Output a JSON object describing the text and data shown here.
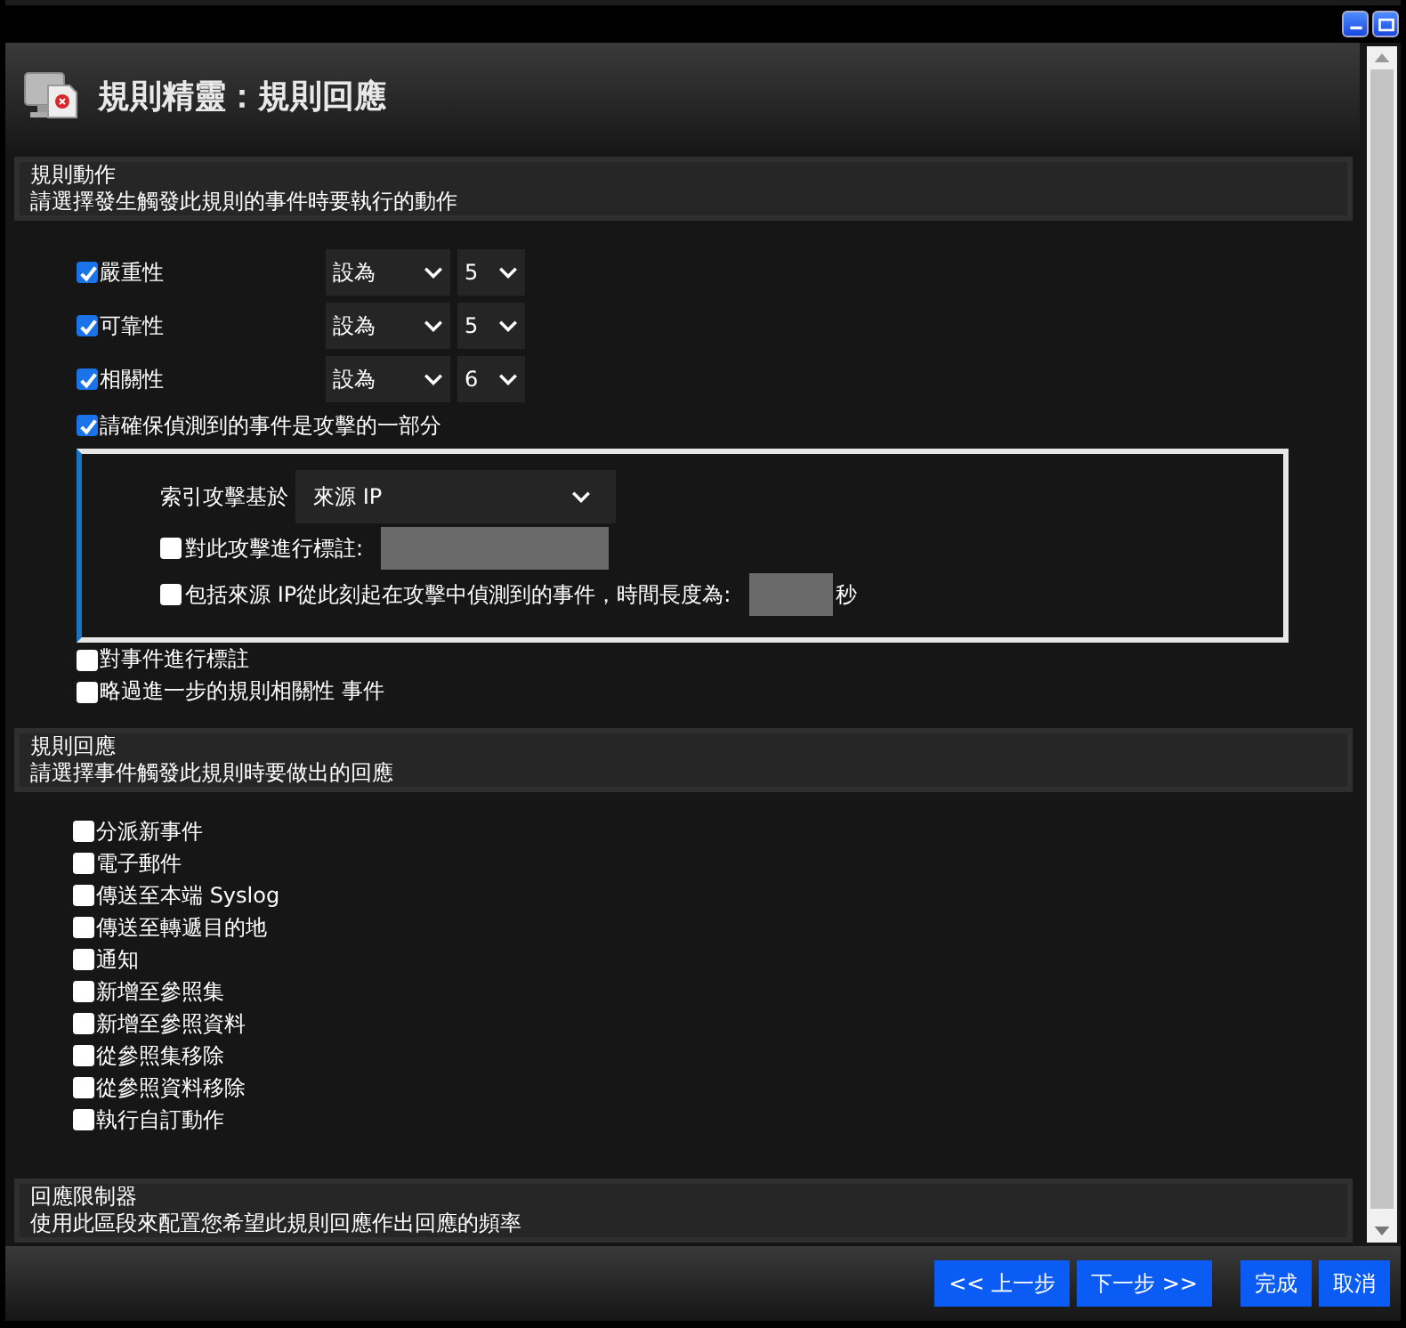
{
  "header": {
    "title": "規則精靈：規則回應"
  },
  "rule_action": {
    "title": "規則動作",
    "description": "請選擇發生觸發此規則的事件時要執行的動作",
    "properties": [
      {
        "label": "嚴重性",
        "checked": true,
        "operator": "設為",
        "value": "5"
      },
      {
        "label": "可靠性",
        "checked": true,
        "operator": "設為",
        "value": "5"
      },
      {
        "label": "相關性",
        "checked": true,
        "operator": "設為",
        "value": "6"
      }
    ],
    "attack": {
      "label": "請確保偵測到的事件是攻擊的一部分",
      "checked": true,
      "index_label": "索引攻擊基於",
      "index_value": "來源 IP",
      "annotate": {
        "label": "對此攻擊進行標註:",
        "checked": false
      },
      "include": {
        "label": "包括來源 IP從此刻起在攻擊中偵測到的事件，時間長度為:",
        "checked": false,
        "unit": "秒"
      }
    },
    "extras": [
      {
        "label": "對事件進行標註",
        "checked": false
      },
      {
        "label": "略過進一步的規則相關性 事件",
        "checked": false
      }
    ]
  },
  "rule_response": {
    "title": "規則回應",
    "description": "請選擇事件觸發此規則時要做出的回應",
    "responses": [
      {
        "label": "分派新事件",
        "checked": false
      },
      {
        "label": "電子郵件",
        "checked": false
      },
      {
        "label": "傳送至本端 Syslog",
        "checked": false
      },
      {
        "label": "傳送至轉遞目的地",
        "checked": false
      },
      {
        "label": "通知",
        "checked": false
      },
      {
        "label": "新增至參照集",
        "checked": false
      },
      {
        "label": "新增至參照資料",
        "checked": false
      },
      {
        "label": "從參照集移除",
        "checked": false
      },
      {
        "label": "從參照資料移除",
        "checked": false
      },
      {
        "label": "執行自訂動作",
        "checked": false
      }
    ]
  },
  "limiter": {
    "title": "回應限制器",
    "description": "使用此區段來配置您希望此規則回應作出回應的頻率"
  },
  "buttons": [
    {
      "label": "<< 上一步"
    },
    {
      "label": "下一步 >>"
    },
    {
      "label": "完成"
    },
    {
      "label": "取消"
    }
  ]
}
